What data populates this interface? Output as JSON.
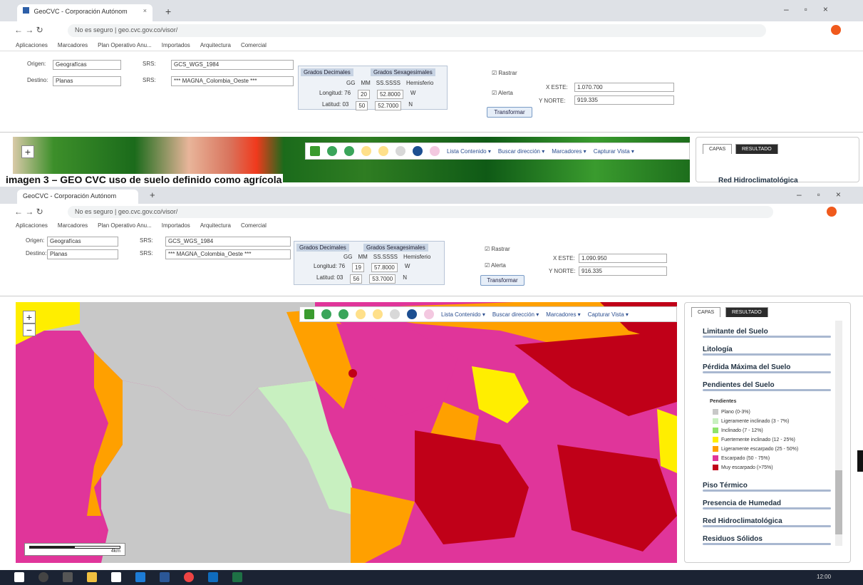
{
  "caption": "imagen 3 – GEO CVC uso de suelo definido como agrícola",
  "top": {
    "tab_title": "GeoCVC - Corporación Autónom",
    "url": "No es seguro | geo.cvc.gov.co/visor/",
    "bookmarks": [
      "Aplicaciones",
      "Marcadores",
      "Plan Operativo Anu...",
      "Importados",
      "Arquitectura",
      "Comercial"
    ],
    "origen_label": "Origen:",
    "origen_value": "Geografícas",
    "destino_label": "Destino:",
    "destino_value": "Planas",
    "srs1_label": "SRS:",
    "srs1_value": "GCS_WGS_1984",
    "srs2_label": "SRS:",
    "srs2_value": "*** MAGNA_Colombia_Oeste ***",
    "radio1": "Grados Decimales",
    "radio2": "Grados Sexagesimales",
    "cols": [
      "GG",
      "MM",
      "SS.SSSS",
      "Hemisferio"
    ],
    "lon_label": "Longitud: 76",
    "lon_vals": [
      "20",
      "52.8000",
      "W"
    ],
    "lat_label": "Latitud: 03",
    "lat_vals": [
      "50",
      "52.7000",
      "N"
    ],
    "cb1": "Rastrar",
    "cb2": "Alerta",
    "transform": "Transformar",
    "x_label": "X ESTE:",
    "x_val": "1.070.700",
    "y_label": "Y NORTE:",
    "y_val": "919.335",
    "tools": [
      "Lista Contenido ▾",
      "Buscar dirección ▾",
      "Marcadores ▾",
      "Capturar Vista ▾"
    ],
    "panel_tabs": [
      "CAPAS",
      "RESULTADO"
    ],
    "panel_layer": "Red Hidroclimatológica"
  },
  "bottom": {
    "tab_title": "GeoCVC - Corporación Autónom",
    "url": "No es seguro | geo.cvc.gov.co/visor/",
    "bookmarks": [
      "Aplicaciones",
      "Marcadores",
      "Plan Operativo Anu...",
      "Importados",
      "Arquitectura",
      "Comercial"
    ],
    "origen_label": "Origen:",
    "origen_value": "Geografícas",
    "destino_label": "Destino:",
    "destino_value": "Planas",
    "srs1_label": "SRS:",
    "srs1_value": "GCS_WGS_1984",
    "srs2_label": "SRS:",
    "srs2_value": "*** MAGNA_Colombia_Oeste ***",
    "radio1": "Grados Decimales",
    "radio2": "Grados Sexagesimales",
    "cols": [
      "GG",
      "MM",
      "SS.SSSS",
      "Hemisferio"
    ],
    "lon_label": "Longitud: 76",
    "lon_vals": [
      "19",
      "57.8000",
      "W"
    ],
    "lat_label": "Latitud: 03",
    "lat_vals": [
      "56",
      "53.7000",
      "N"
    ],
    "cb1": "Rastrar",
    "cb2": "Alerta",
    "transform": "Transformar",
    "x_label": "X ESTE:",
    "x_val": "1.090.950",
    "y_label": "Y NORTE:",
    "y_val": "916.335",
    "tools": [
      "Lista Contenido ▾",
      "Buscar dirección ▾",
      "Marcadores ▾",
      "Capturar Vista ▾"
    ],
    "panel_tabs": [
      "CAPAS",
      "RESULTADO"
    ],
    "layers_top": [
      "Limitante del Suelo",
      "Litología",
      "Pérdida Máxima del Suelo",
      "Pendientes del Suelo"
    ],
    "legend_title": "Pendientes",
    "legend": [
      {
        "label": "Plano (0-3%)",
        "color": "#c8c8c8"
      },
      {
        "label": "Ligeramente inclinado (3 - 7%)",
        "color": "#c8f0c0"
      },
      {
        "label": "Inclinado (7 - 12%)",
        "color": "#8fe36b"
      },
      {
        "label": "Fuertemente inclinado (12 - 25%)",
        "color": "#ffee00"
      },
      {
        "label": "Ligeramente escarpado (25 - 50%)",
        "color": "#ffa000"
      },
      {
        "label": "Escarpado (50 - 75%)",
        "color": "#e0359a"
      },
      {
        "label": "Muy escarpado (>75%)",
        "color": "#c00018"
      }
    ],
    "layers_bottom": [
      "Piso Térmico",
      "Presencia de Humedad",
      "Red Hidroclimatológica",
      "Residuos Sólidos"
    ],
    "scale_label": "4km",
    "clock": "12:00"
  }
}
